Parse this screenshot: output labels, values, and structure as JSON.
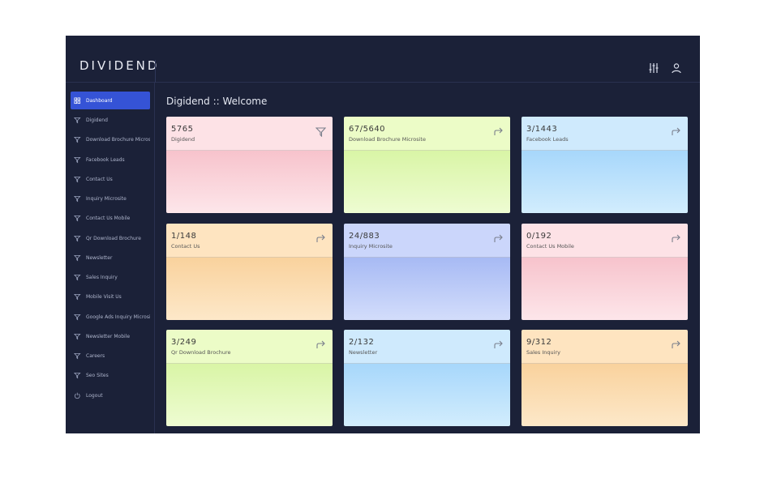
{
  "brand": {
    "logo_text": "DIVIDEND"
  },
  "header": {
    "icons": [
      "sliders-icon",
      "user-icon"
    ]
  },
  "page": {
    "title": "Digidend :: Welcome"
  },
  "sidebar": {
    "items": [
      {
        "label": "Dashboard",
        "icon": "grid-icon",
        "active": true
      },
      {
        "label": "Digidend",
        "icon": "funnel-icon"
      },
      {
        "label": "Download Brochure Microsite",
        "icon": "funnel-icon"
      },
      {
        "label": "Facebook Leads",
        "icon": "funnel-icon"
      },
      {
        "label": "Contact Us",
        "icon": "funnel-icon"
      },
      {
        "label": "Inquiry Microsite",
        "icon": "funnel-icon"
      },
      {
        "label": "Contact Us Mobile",
        "icon": "funnel-icon"
      },
      {
        "label": "Qr Download Brochure",
        "icon": "funnel-icon"
      },
      {
        "label": "Newsletter",
        "icon": "funnel-icon"
      },
      {
        "label": "Sales Inquiry",
        "icon": "funnel-icon"
      },
      {
        "label": "Mobile Visit Us",
        "icon": "funnel-icon"
      },
      {
        "label": "Google Ads Inquiry Microsite",
        "icon": "funnel-icon"
      },
      {
        "label": "Newsletter Mobile",
        "icon": "funnel-icon"
      },
      {
        "label": "Careers",
        "icon": "funnel-icon"
      },
      {
        "label": "Seo Sites",
        "icon": "funnel-icon"
      },
      {
        "label": "Logout",
        "icon": "power-icon"
      }
    ]
  },
  "cards": [
    {
      "count": "5765",
      "label": "Digidend",
      "icon": "funnel-icon",
      "color": "pink"
    },
    {
      "count": "67/5640",
      "label": "Download Brochure Microsite",
      "icon": "share-arrow-icon",
      "color": "green"
    },
    {
      "count": "3/1443",
      "label": "Facebook Leads",
      "icon": "share-arrow-icon",
      "color": "blue"
    },
    {
      "count": "1/148",
      "label": "Contact Us",
      "icon": "share-arrow-icon",
      "color": "orange"
    },
    {
      "count": "24/883",
      "label": "Inquiry Microsite",
      "icon": "share-arrow-icon",
      "color": "indigo"
    },
    {
      "count": "0/192",
      "label": "Contact Us Mobile",
      "icon": "share-arrow-icon",
      "color": "pink"
    },
    {
      "count": "3/249",
      "label": "Qr Download Brochure",
      "icon": "share-arrow-icon",
      "color": "green"
    },
    {
      "count": "2/132",
      "label": "Newsletter",
      "icon": "share-arrow-icon",
      "color": "blue"
    },
    {
      "count": "9/312",
      "label": "Sales Inquiry",
      "icon": "share-arrow-icon",
      "color": "orange"
    }
  ]
}
